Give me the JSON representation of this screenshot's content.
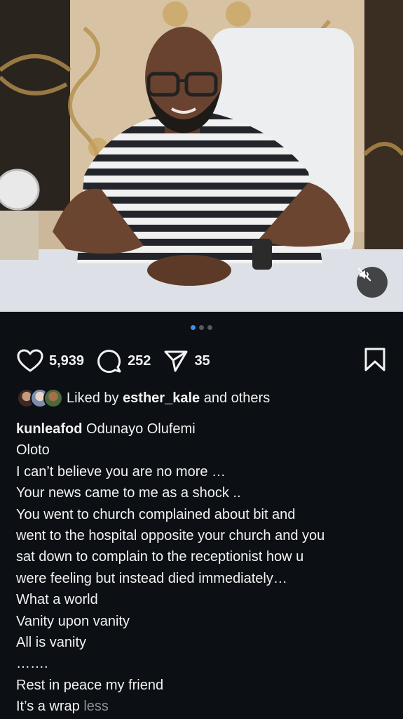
{
  "post": {
    "carousel": {
      "total": 3,
      "active_index": 0
    },
    "mute_icon": "speaker-muted-icon"
  },
  "actions": {
    "likes": "5,939",
    "comments": "252",
    "shares": "35"
  },
  "liked_by": {
    "prefix": "Liked by",
    "user": "esther_kale",
    "suffix": "and others"
  },
  "caption": {
    "username": "kunleafod",
    "first_line_text": "Odunayo Olufemi",
    "lines": [
      "Oloto",
      "I can’t believe you are no more …",
      "Your news came to me as a shock ..",
      "You went to church complained about bit and",
      "went to the hospital opposite your church and you",
      "sat down to complain to the receptionist how u",
      "were feeling but instead died immediately…",
      "What a world",
      "Vanity upon vanity",
      "All is vanity",
      "…….",
      "Rest in peace my friend"
    ],
    "last_line_text": "It’s a wrap",
    "less_label": "less"
  },
  "colors": {
    "background": "#0c0f14",
    "active_dot": "#3a8ff5",
    "muted_text": "#8e9196"
  }
}
